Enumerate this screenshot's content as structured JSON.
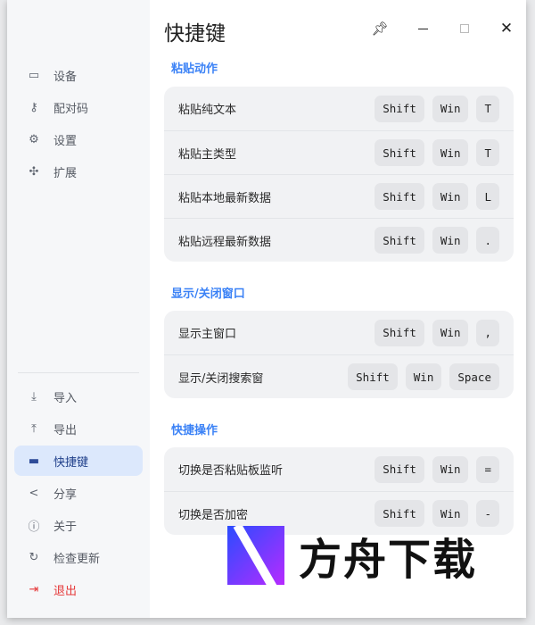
{
  "sidebar": {
    "top": [
      {
        "label": "设备",
        "icon": "devices-icon"
      },
      {
        "label": "配对码",
        "icon": "key-icon"
      },
      {
        "label": "设置",
        "icon": "gear-icon"
      },
      {
        "label": "扩展",
        "icon": "puzzle-icon"
      }
    ],
    "bottom": [
      {
        "label": "导入",
        "icon": "download-icon"
      },
      {
        "label": "导出",
        "icon": "upload-icon"
      },
      {
        "label": "快捷键",
        "icon": "keyboard-icon"
      },
      {
        "label": "分享",
        "icon": "share-icon"
      },
      {
        "label": "关于",
        "icon": "info-icon"
      },
      {
        "label": "检查更新",
        "icon": "refresh-icon"
      },
      {
        "label": "退出",
        "icon": "logout-icon"
      }
    ]
  },
  "header": {
    "title": "快捷键"
  },
  "sections": [
    {
      "title": "粘贴动作",
      "rows": [
        {
          "label": "粘贴纯文本",
          "keys": [
            "Shift",
            "Win",
            "T"
          ]
        },
        {
          "label": "粘贴主类型",
          "keys": [
            "Shift",
            "Win",
            "T"
          ]
        },
        {
          "label": "粘贴本地最新数据",
          "keys": [
            "Shift",
            "Win",
            "L"
          ]
        },
        {
          "label": "粘贴远程最新数据",
          "keys": [
            "Shift",
            "Win",
            "."
          ]
        }
      ]
    },
    {
      "title": "显示/关闭窗口",
      "rows": [
        {
          "label": "显示主窗口",
          "keys": [
            "Shift",
            "Win",
            ","
          ]
        },
        {
          "label": "显示/关闭搜索窗",
          "keys": [
            "Shift",
            "Win",
            "Space"
          ]
        }
      ]
    },
    {
      "title": "快捷操作",
      "rows": [
        {
          "label": "切换是否粘贴板监听",
          "keys": [
            "Shift",
            "Win",
            "="
          ]
        },
        {
          "label": "切换是否加密",
          "keys": [
            "Shift",
            "Win",
            "-"
          ]
        }
      ]
    }
  ],
  "watermark": "方舟下载",
  "colors": {
    "accent": "#3b82f6",
    "active_bg": "#dce8fc",
    "danger": "#e5393a"
  }
}
